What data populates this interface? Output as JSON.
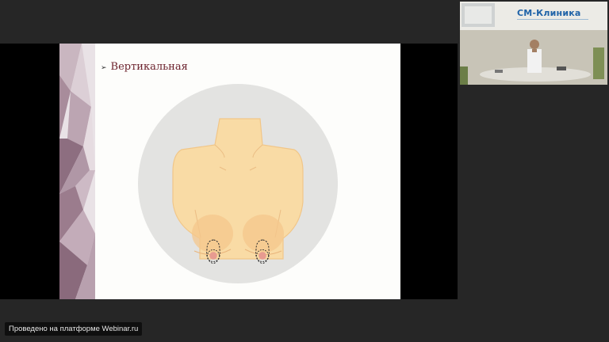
{
  "slide": {
    "title_marker": "➢",
    "title": "Вертикальная",
    "illustration_icon": "breast-incision-vertical-diagram"
  },
  "webcam": {
    "clinic_logo": "СМ-Клиника",
    "accent_color": "#1f63a8"
  },
  "footer": {
    "watermark": "Проведено на платформе Webinar.ru"
  },
  "colors": {
    "background": "#262626",
    "slide_title": "#6a1f2a",
    "skin": "#f9dba5",
    "circle": "#e3e3e1",
    "deco_purple": "#9e7f90"
  }
}
